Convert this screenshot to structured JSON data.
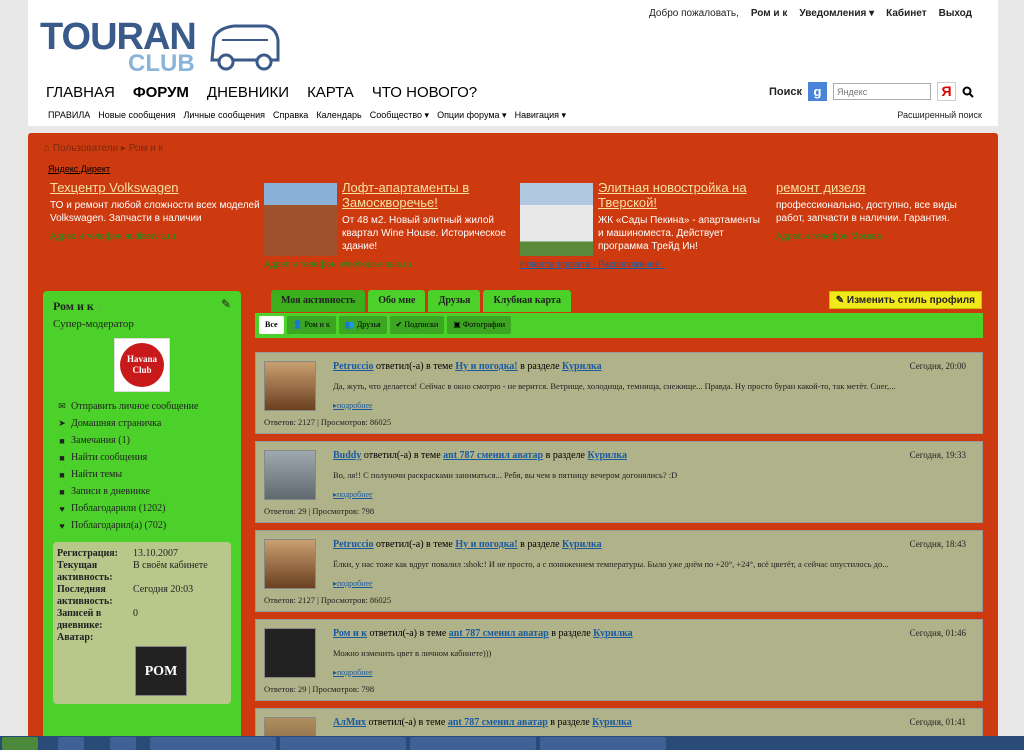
{
  "header": {
    "logo_main": "TOURAN",
    "logo_sub": "CLUB",
    "welcome": "Добро пожаловать,",
    "username": "Ром и к",
    "notifications": "Уведомления ▾",
    "cabinet": "Кабинет",
    "logout": "Выход",
    "nav": [
      "ГЛАВНАЯ",
      "ФОРУМ",
      "ДНЕВНИКИ",
      "КАРТА",
      "ЧТО НОВОГО?"
    ],
    "subnav": [
      "ПРАВИЛА",
      "Новые сообщения",
      "Личные сообщения",
      "Справка",
      "Календарь",
      "Сообщество ▾",
      "Опции форума ▾",
      "Навигация ▾"
    ],
    "search_label": "Поиск",
    "search_placeholder": "Яндекс",
    "advanced_search": "Расширенный поиск"
  },
  "breadcrumb": [
    "Пользователи",
    "Ром и к"
  ],
  "yandex_direct": "Яндекс.Директ",
  "ads": [
    {
      "title": "Техцентр Volkswagen",
      "desc": "ТО и ремонт любой сложности всех моделей Volkswagen. Запчасти в наличии",
      "url": "Адрес и телефон  audiservis.ru"
    },
    {
      "title": "Лофт-апартаменты в Замоскворечье!",
      "desc": "От 48 м2. Новый элитный жилой квартал Wine House. Историческое здание!",
      "url": "Адрес и телефон  winehouse-hals.ru"
    },
    {
      "title": "Элитная новостройка на Тверской!",
      "desc": "ЖК «Сады Пекина» - апартаменты и машиноместа. Действует программа Трейд Ин!",
      "url": "Новости проекта  ·  Расположение  ·"
    },
    {
      "title": "ремонт дизеля",
      "desc": "профессионально, доступно, все виды работ, запчасти в наличии. Гарантия.",
      "url": "Адрес и телефон  Москва"
    }
  ],
  "profile": {
    "name": "Ром и к",
    "role": "Супер-модератор",
    "avatar_text": "Havana Club",
    "links": [
      {
        "icon": "✉",
        "label": "Отправить личное сообщение"
      },
      {
        "icon": "➤",
        "label": "Домашняя страничка"
      },
      {
        "icon": "■",
        "label": "Замечания (1)"
      },
      {
        "icon": "■",
        "label": "Найти сообщения"
      },
      {
        "icon": "■",
        "label": "Найти темы"
      },
      {
        "icon": "■",
        "label": "Записи в дневнике"
      },
      {
        "icon": "♥",
        "label": "Поблагодарили (1202)"
      },
      {
        "icon": "♥",
        "label": "Поблагодарил(а) (702)"
      }
    ],
    "info": [
      {
        "k": "Регистрация:",
        "v": "13.10.2007"
      },
      {
        "k": "Текущая активность:",
        "v": "В своём кабинете"
      },
      {
        "k": "Последняя активность:",
        "v": "Сегодня 20:03"
      },
      {
        "k": "Записей в дневнике:",
        "v": "0"
      },
      {
        "k": "Аватар:",
        "v": ""
      }
    ],
    "avatar2": "РОМ"
  },
  "tabs": [
    "Моя активность",
    "Обо мне",
    "Друзья",
    "Клубная карта"
  ],
  "style_button": "Изменить стиль профиля",
  "filters": [
    "Все",
    "Ром и к",
    "Друзья",
    "Подписки",
    "Фотографии"
  ],
  "posts": [
    {
      "user": "Petruccio",
      "action": " ответил(-а) в теме ",
      "topic": "Ну и погодка!",
      "section_pre": " в разделе ",
      "section": "Курилка",
      "time": "Сегодня, 20:00",
      "text": "Да, жуть, что делается! Сейчас в окно смотрю - не верится. Ветрище, холодища, темнища, снежище... Правда. Ну просто буран какой-то, так метёт. Снег,...",
      "more": "подробнее",
      "stats": "Ответов: 2127 | Просмотров: 86025"
    },
    {
      "user": "Buddy",
      "action": " ответил(-а) в теме ",
      "topic": "ant 787 сменил аватар",
      "section_pre": " в разделе ",
      "section": "Курилка",
      "time": "Сегодня, 19:33",
      "text": "Во, ля!! С полуночи раскрасками заниматься... Ребя, вы чем в пятницу вечером догонялись? :D",
      "more": "подробнее",
      "stats": "Ответов: 29 | Просмотров: 798"
    },
    {
      "user": "Petruccio",
      "action": " ответил(-а) в теме ",
      "topic": "Ну и погодка!",
      "section_pre": " в разделе ",
      "section": "Курилка",
      "time": "Сегодня, 18:43",
      "text": "Ёлки, у нас тоже как вдруг повалил :shok:! И не просто, а с понижением температуры. Было уже днём по +20°, +24°, всё цветёт, а сейчас опустилось до...",
      "more": "подробнее",
      "stats": "Ответов: 2127 | Просмотров: 86025"
    },
    {
      "user": "Ром и к",
      "action": " ответил(-а) в теме ",
      "topic": "ant 787 сменил аватар",
      "section_pre": " в разделе ",
      "section": "Курилка",
      "time": "Сегодня, 01:46",
      "text": "Можно изменить цвет в личном кабинете)))",
      "more": "подробнее",
      "stats": "Ответов: 29 | Просмотров: 798"
    },
    {
      "user": "АлМих",
      "action": " ответил(-а) в теме ",
      "topic": "ant 787 сменил аватар",
      "section_pre": " в разделе ",
      "section": "Курилка",
      "time": "Сегодня, 01:41",
      "text": "",
      "more": "",
      "stats": ""
    }
  ]
}
